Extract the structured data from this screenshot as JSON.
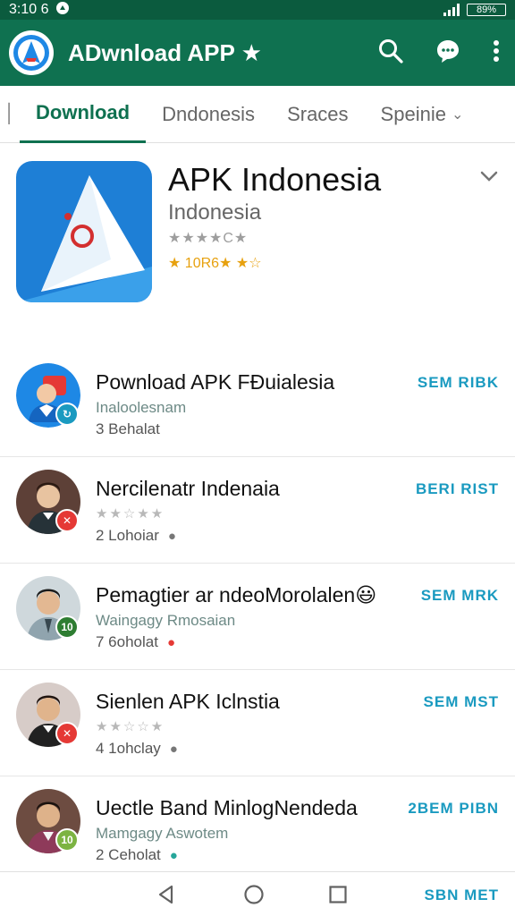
{
  "status": {
    "time": "3:10 6",
    "battery": "89%"
  },
  "app_bar": {
    "title": "ADwnload APP ★",
    "logo_icon": "app-logo-icon",
    "search_icon": "search-icon",
    "chat_icon": "chat-icon",
    "more_icon": "more-vert-icon",
    "color": "#0f7150"
  },
  "tabs": {
    "items": [
      {
        "label": "Download"
      },
      {
        "label": "Dndonesis"
      },
      {
        "label": "Sraces"
      },
      {
        "label": "Speinie"
      }
    ],
    "active_index": 0
  },
  "hero": {
    "title": "APK Indonesia",
    "subtitle": "Indonesia",
    "rating_text": "★★★★C★",
    "meta": "★ 10R6★",
    "meta_tail": "★☆"
  },
  "list": {
    "items": [
      {
        "title": "Pownload APK FĐuialesia",
        "subtitle": "Inaloolesnam",
        "meta": "3 Behalat",
        "action": "SEM RIBK",
        "badge": "",
        "badge_color": "#1a9ac0"
      },
      {
        "title": "Nercilenatr Indenaia",
        "stars": "★★☆★★",
        "meta": "2 Lohoiar",
        "action": "BERI RIST",
        "badge": "✕",
        "badge_color": "#e53935"
      },
      {
        "title": "Pemagtier ar ndeoMorolalen😃",
        "subtitle": "Waingagy Rmosaian",
        "meta": "7 6oholat",
        "action": "SEM MRK",
        "badge": "10",
        "badge_color": "#2e7d32"
      },
      {
        "title": "Sienlen APK Iclnstia",
        "stars": "★★☆☆★",
        "meta": "4 1ohclay",
        "action": "SEM MST",
        "badge": "✕",
        "badge_color": "#e53935"
      },
      {
        "title": "Uectle Band MinlogNendeda",
        "subtitle": "Mamgagy Aswotem",
        "meta": "2 Ceholat",
        "action": "2BEM PIBN",
        "badge": "10",
        "badge_color": "#7cb342"
      }
    ]
  },
  "nav": {
    "back_icon": "back-icon",
    "home_icon": "home-icon",
    "recents_icon": "recents-icon",
    "action": "SBN MET"
  }
}
